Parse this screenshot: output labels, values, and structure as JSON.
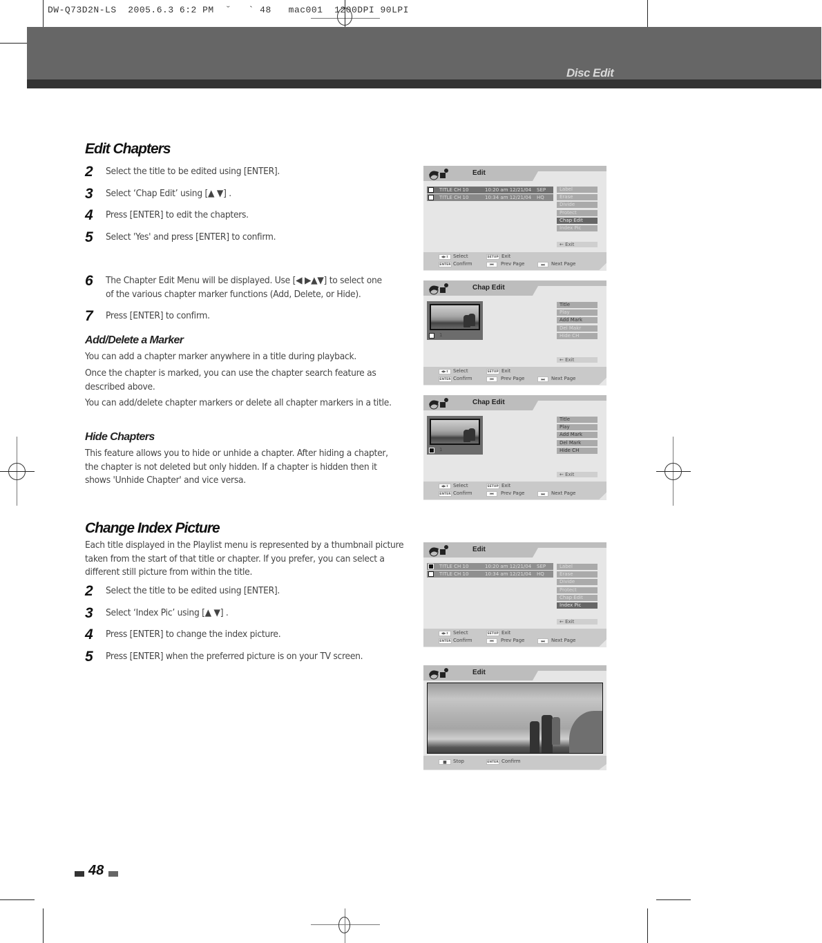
{
  "print_slug": "DW-Q73D2N-LS  2005.6.3 6:2 PM  ˘   ` 48   mac001  1200DPI 90LPI",
  "header": {
    "section_title": "Disc Edit"
  },
  "edit_chapters": {
    "title": "Edit Chapters",
    "steps_a": [
      {
        "num": "2",
        "text": "Select the title to be edited using [ENTER]."
      },
      {
        "num": "3",
        "text": "Select ‘Chap Edit’ using [▲ ▼] ."
      },
      {
        "num": "4",
        "text": "Press [ENTER] to edit the chapters."
      },
      {
        "num": "5",
        "text": "Select 'Yes'  and press [ENTER] to confirm."
      }
    ],
    "steps_b": [
      {
        "num": "6",
        "text": "The Chapter Edit Menu will be displayed. Use [◀ ▶▲▼] to select one of the various chapter marker functions (Add, Delete, or Hide)."
      },
      {
        "num": "7",
        "text": "Press [ENTER] to confirm."
      }
    ],
    "add_delete": {
      "title": "Add/Delete a Marker",
      "p1": "You can add a chapter marker anywhere in a title during playback.",
      "p2": "Once the chapter is marked, you can use the chapter search feature as described above.",
      "p3": "You can add/delete chapter markers or delete all chapter markers in a title."
    },
    "hide": {
      "title": "Hide Chapters",
      "p1": "This feature allows you to hide or unhide a chapter. After hiding a chapter, the chapter is not deleted but only hidden. If a chapter is hidden then it shows 'Unhide Chapter' and vice versa."
    }
  },
  "change_index": {
    "title": "Change Index  Picture",
    "intro": "Each title displayed in the Playlist menu is represented by a thumbnail picture taken from the start of that title or chapter. If you prefer, you can select a different still picture from within the title.",
    "steps": [
      {
        "num": "2",
        "text": "Select the title to be edited using [ENTER]."
      },
      {
        "num": "3",
        "text": "Select ‘Index Pic’ using [▲ ▼] ."
      },
      {
        "num": "4",
        "text": "Press [ENTER] to change the index picture."
      },
      {
        "num": "5",
        "text": "Press [ENTER] when the preferred picture is on your TV screen."
      }
    ]
  },
  "screens": {
    "edit_title": "Edit",
    "chap_title": "Chap Edit",
    "rows": [
      {
        "name": "TITLE CH 10",
        "time": "10:20 am 12/21/04",
        "quality": "SEP"
      },
      {
        "name": "TITLE CH 10",
        "time": "10:34 am 12/21/04",
        "quality": "HQ"
      }
    ],
    "edit_menu": [
      "Label",
      "Erase",
      "Divide",
      "Protect",
      "Chap Edit",
      "Index Pic"
    ],
    "chap_menu_1": [
      "Title",
      "Play",
      "Add Mark",
      "Del Makr",
      "Hide CH"
    ],
    "chap_menu_2": [
      "Title",
      "Play",
      "Add Mark",
      "Del Mark",
      "Hide CH"
    ],
    "chapter_number": "1",
    "exit": "←   Exit",
    "footer": {
      "select": "Select",
      "exit": "Exit",
      "confirm": "Confirm",
      "prev": "Prev Page",
      "next": "Next Page",
      "stop": "Stop",
      "key_setup": "SETUP",
      "key_enter": "ENTER",
      "key_arrows": "◀▶⇕",
      "key_prev": "⏮",
      "key_next": "⏭",
      "key_stop": "■"
    }
  },
  "page_number": "48"
}
